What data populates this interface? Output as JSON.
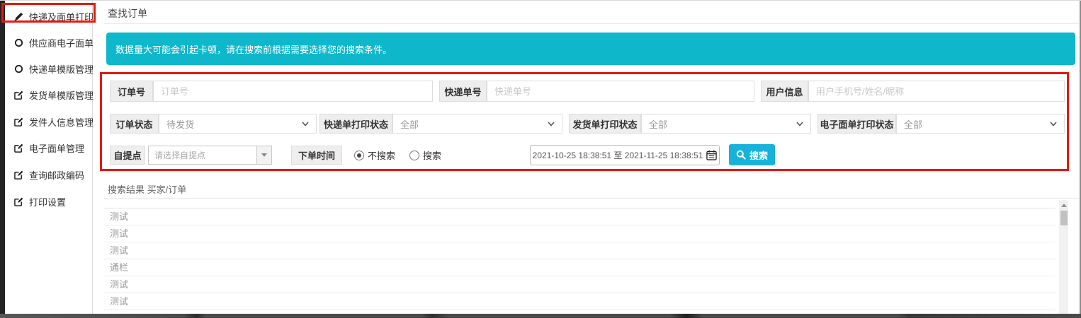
{
  "sidebar": {
    "items": [
      {
        "label": "快递及面单打印",
        "icon": "pen-icon",
        "active": true
      },
      {
        "label": "供应商电子面单",
        "icon": "circle-icon"
      },
      {
        "label": "快递单模版管理",
        "icon": "circle-icon"
      },
      {
        "label": "发货单模版管理",
        "icon": "pen-square-icon"
      },
      {
        "label": "发件人信息管理",
        "icon": "pen-square-icon"
      },
      {
        "label": "电子面单管理",
        "icon": "pen-square-icon"
      },
      {
        "label": "查询邮政编码",
        "icon": "pen-square-icon"
      },
      {
        "label": "打印设置",
        "icon": "pen-square-icon"
      }
    ]
  },
  "header": {
    "title": "查找订单"
  },
  "alert": {
    "text": "数据量大可能会引起卡顿，请在搜索前根据需要选择您的搜索条件。"
  },
  "form": {
    "row1": [
      {
        "label": "订单号",
        "placeholder": "订单号"
      },
      {
        "label": "快递单号",
        "placeholder": "快递单号"
      },
      {
        "label": "用户信息",
        "placeholder": "用户手机号/姓名/昵称"
      }
    ],
    "row2": [
      {
        "label": "订单状态",
        "value": "待发货"
      },
      {
        "label": "快递单打印状态",
        "value": "全部"
      },
      {
        "label": "发货单打印状态",
        "value": "全部"
      },
      {
        "label": "电子面单打印状态",
        "value": "全部"
      }
    ],
    "row3": {
      "pickup_label": "自提点",
      "pickup_placeholder": "请选择自提点",
      "time_label": "下单时间",
      "radio_no_search": "不搜索",
      "radio_search": "搜索",
      "radio_selected": "不搜索",
      "date_range": "2021-10-25 18:38:51 至 2021-11-25 18:38:51",
      "search_label": "搜索"
    }
  },
  "results": {
    "title": "搜索结果 买家/订单",
    "rows": [
      "测试",
      "测试",
      "测试",
      "通栏",
      "测试",
      "测试"
    ]
  },
  "colors": {
    "accent_cyan": "#0fb7cb",
    "button_cyan": "#17b2da",
    "annotation_red": "#e8170d",
    "sidebar_strip": "#232323"
  },
  "icons": {
    "sidebar_item_1": "pen-icon",
    "sidebar_items_2_3": "circle-icon",
    "sidebar_items_4_8": "pen-square-icon",
    "search_button": "magnifier-icon",
    "date_field": "calendar-icon",
    "selects": "chevron-down-icon",
    "pickup_combo": "triangle-down-icon"
  }
}
